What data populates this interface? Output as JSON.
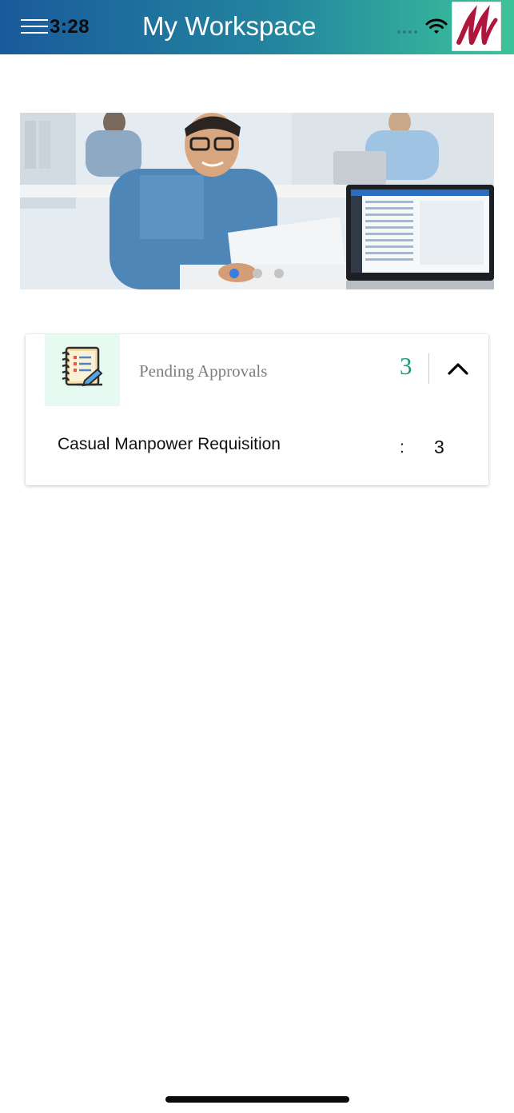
{
  "status_bar": {
    "time": "3:28"
  },
  "header": {
    "title": "My Workspace",
    "logo_letters": "M",
    "brand_color": "#b0163b"
  },
  "carousel": {
    "active_index": 0,
    "count": 3,
    "active_color": "#3a7be0",
    "inactive_color": "#c4c4c4"
  },
  "pending_card": {
    "title": "Pending Approvals",
    "count": "3",
    "accent": "#1a9a7a",
    "items": [
      {
        "label": "Casual Manpower Requisition",
        "separator": ":",
        "value": "3"
      }
    ]
  }
}
